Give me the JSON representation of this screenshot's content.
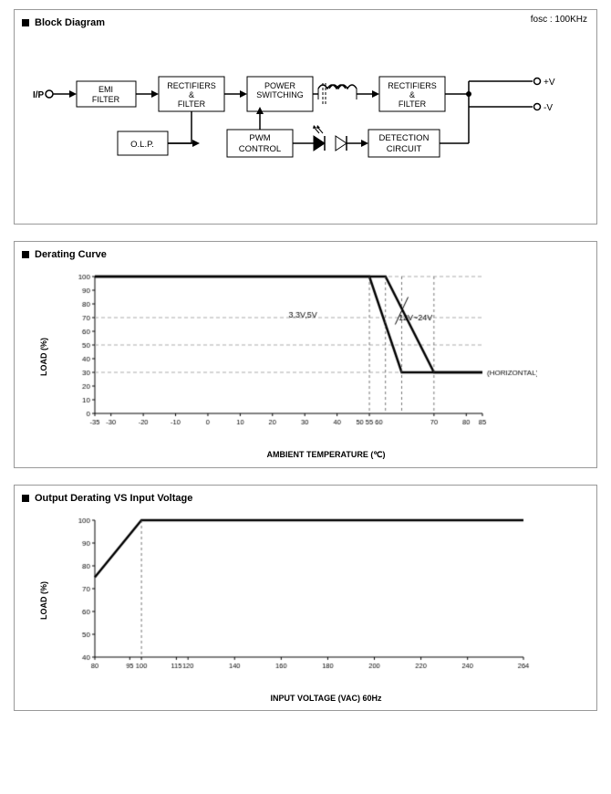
{
  "blockDiagram": {
    "title": "Block Diagram",
    "foscLabel": "fosc : 100KHz",
    "blocks": [
      {
        "id": "emi",
        "label": "EMI\nFILTER"
      },
      {
        "id": "rect1",
        "label": "RECTIFIERS\n&\nFILTER"
      },
      {
        "id": "power",
        "label": "POWER\nSWITCHING"
      },
      {
        "id": "rect2",
        "label": "RECTIFIERS\n&\nFILTER"
      },
      {
        "id": "olp",
        "label": "O.L.P."
      },
      {
        "id": "pwm",
        "label": "PWM\nCONTROL"
      },
      {
        "id": "detection",
        "label": "DETECTION\nCIRCUIT"
      }
    ],
    "ipLabel": "I/P",
    "vplusLabel": "+V",
    "vminusLabel": "-V"
  },
  "deratingCurve": {
    "title": "Derating Curve",
    "yAxisLabel": "LOAD (%)",
    "xAxisLabel": "AMBIENT TEMPERATURE (℃)",
    "yTicks": [
      0,
      10,
      20,
      30,
      40,
      50,
      60,
      70,
      80,
      90,
      100
    ],
    "xTicks": [
      -35,
      -30,
      -20,
      -10,
      0,
      10,
      20,
      30,
      40,
      "50 55 60",
      70,
      80,
      85
    ],
    "xTicksDisplay": [
      "-35",
      "-30",
      "-20",
      "-10",
      "0",
      "10",
      "20",
      "30",
      "40",
      "50 55 60",
      "70",
      "80",
      "85"
    ],
    "label1": "3.3V,5V",
    "label2": "12V~24V",
    "horizontalLabel": "(HORIZONTAL)"
  },
  "outputDerating": {
    "title": "Output Derating VS Input Voltage",
    "yAxisLabel": "LOAD (%)",
    "xAxisLabel": "INPUT VOLTAGE (VAC) 60Hz",
    "yTicks": [
      40,
      50,
      60,
      70,
      80,
      90,
      100
    ],
    "xTicksDisplay": [
      "80",
      "95",
      "100",
      "115",
      "120",
      "140",
      "160",
      "180",
      "200",
      "220",
      "240",
      "264"
    ]
  }
}
